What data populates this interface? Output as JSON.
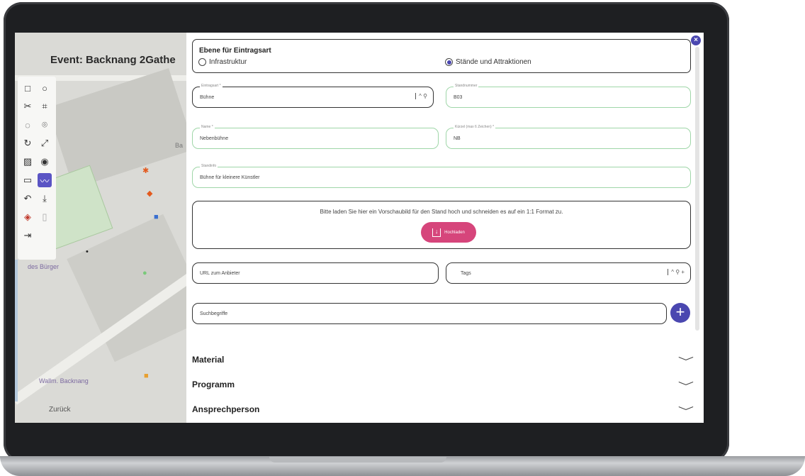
{
  "map": {
    "event_title": "Event: Backnang 2Gathe",
    "back_label": "Zurück",
    "labels": [
      "Wallm. Backnang",
      "des Bürger",
      "Ba"
    ],
    "tools": [
      "square-icon",
      "circle-icon",
      "scissors-icon",
      "polygon-edit-icon",
      "dashed-circle-icon",
      "location-pin-icon",
      "rotate-icon",
      "resize-icon",
      "image-icon",
      "eye-icon",
      "keyboard-icon",
      "line-chart-icon",
      "undo-icon",
      "download-icon",
      "layers-icon",
      "copy-icon",
      "logout-icon"
    ]
  },
  "panel": {
    "close_label": "×",
    "layer": {
      "title": "Ebene für Eintragsart",
      "options": [
        "Infrastruktur",
        "Stände und Attraktionen"
      ],
      "selected": "Stände und Attraktionen"
    },
    "fields": {
      "eintragsart": {
        "label": "Eintragsart *",
        "value": "Bühne",
        "icons": "^ ⚲"
      },
      "standnummer": {
        "label": "Standnummer",
        "value": "B03"
      },
      "name": {
        "label": "Name *",
        "value": "Nebenbühne"
      },
      "kurzel": {
        "label": "Kürzel (max 6 Zeichen) *",
        "value": "NB"
      },
      "standinfo": {
        "label": "Standinfo",
        "value": "Bühne für kleinere Künstler"
      },
      "url": {
        "label": "",
        "value": "URL zum Anbieter"
      },
      "tags": {
        "label": "",
        "value": "Tags",
        "icons": "^ ⚲ +"
      },
      "suchbegriffe": {
        "label": "",
        "value": "Suchbegriffe"
      }
    },
    "upload": {
      "text": "Bitte laden Sie hier ein Vorschaubild für den Stand hoch und schneiden es auf ein 1:1 Format zu.",
      "button": "Hochladen"
    },
    "add_label": "+",
    "sections": [
      "Material",
      "Programm",
      "Ansprechperson"
    ],
    "chevron": "﹀"
  },
  "colors": {
    "accent": "#4a47b0",
    "upload": "#d6457b",
    "valid_border": "#9fd6a8"
  }
}
